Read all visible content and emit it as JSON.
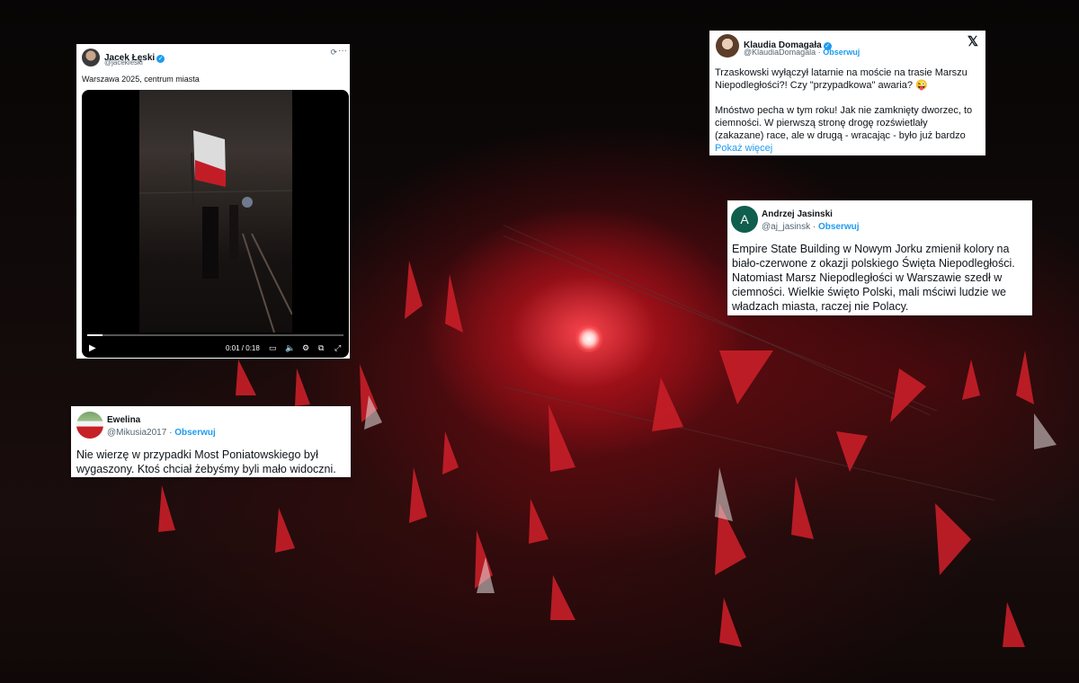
{
  "tweets": {
    "lecki": {
      "name": "Jacek Łęski",
      "handle": "@jacekleski",
      "text": "Warszawa 2025, centrum miasta",
      "video_time": "0:01 / 0:18",
      "video_progress": 0.06
    },
    "domagala": {
      "name": "Klaudia Domagała",
      "handle": "@KlaudiaDomagala",
      "separator": "·",
      "follow": "Obserwuj",
      "platform_icon": "x-logo-icon",
      "paragraph1": "Trzaskowski wyłączył latarnie na moście na trasie Marszu Niepodległości?! Czy \"przypadkowa\" awaria? 😜",
      "paragraph2": "Mnóstwo pecha w tym roku! Jak nie zamknięty dworzec, to ciemności. W pierwszą stronę drogę rozświetlały (zakazane) race, ale w drugą - wracając - było już bardzo",
      "more": "Pokaż więcej"
    },
    "jasinski": {
      "name": "Andrzej Jasinski",
      "handle": "@aj_jasinsk",
      "separator": "·",
      "follow": "Obserwuj",
      "avatar_letter": "A",
      "text": "Empire State Building w Nowym Jorku zmienił kolory na biało-czerwone z okazji polskiego Święta Niepodległości. Natomiast Marsz Niepodległości w Warszawie szedł w ciemności. Wielkie święto Polski, mali mściwi ludzie we władzach miasta, raczej nie Polacy."
    },
    "ewelina": {
      "name": "Ewelina",
      "handle": "@Mikusia2017",
      "separator": "·",
      "follow": "Obserwuj",
      "text": "Nie wierzę w przypadki Most Poniatowskiego był wygaszony. Ktoś chciał żebyśmy byli mało widoczni."
    }
  },
  "colors": {
    "accent": "#1d9bf0",
    "flag_red": "#d4202b",
    "flare": "#ff3b45",
    "avatar_jasinski": "#0f5e4e"
  }
}
